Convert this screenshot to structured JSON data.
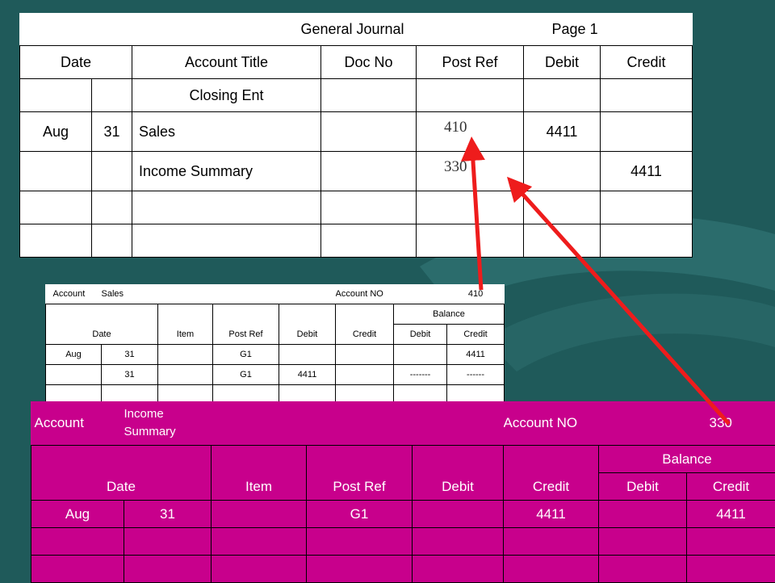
{
  "journal": {
    "title": "General Journal",
    "page": "Page 1",
    "headers": {
      "date": "Date",
      "account_title": "Account Title",
      "doc_no": "Doc No",
      "post_ref": "Post Ref",
      "debit": "Debit",
      "credit": "Credit"
    },
    "rows": [
      {
        "month": "",
        "day": "",
        "account": "Closing Ent",
        "doc": "",
        "post_ref": "",
        "debit": "",
        "credit": ""
      },
      {
        "month": "Aug",
        "day": "31",
        "account": "Sales",
        "doc": "",
        "post_ref": "410",
        "debit": "4411",
        "credit": ""
      },
      {
        "month": "",
        "day": "",
        "account": "Income Summary",
        "doc": "",
        "post_ref": "330",
        "debit": "",
        "credit": "4411"
      }
    ]
  },
  "sales_ledger": {
    "account_label": "Account",
    "account_name": "Sales",
    "account_no_label": "Account NO",
    "account_no": "410",
    "headers": {
      "date": "Date",
      "item": "Item",
      "post_ref": "Post Ref",
      "debit": "Debit",
      "credit": "Credit",
      "balance": "Balance",
      "bal_debit": "Debit",
      "bal_credit": "Credit"
    },
    "rows": [
      {
        "month": "Aug",
        "day": "31",
        "item": "",
        "post_ref": "G1",
        "debit": "",
        "credit": "",
        "bal_debit": "",
        "bal_credit": "4411"
      },
      {
        "month": "",
        "day": "31",
        "item": "",
        "post_ref": "G1",
        "debit": "4411",
        "credit": "",
        "bal_debit": "-------",
        "bal_credit": "------"
      }
    ]
  },
  "income_ledger": {
    "account_label": "Account",
    "account_name": "Income Summary",
    "account_no_label": "Account NO",
    "account_no": "330",
    "headers": {
      "date": "Date",
      "item": "Item",
      "post_ref": "Post Ref",
      "debit": "Debit",
      "credit": "Credit",
      "balance": "Balance",
      "bal_debit": "Debit",
      "bal_credit": "Credit"
    },
    "rows": [
      {
        "month": "Aug",
        "day": "31",
        "item": "",
        "post_ref": "G1",
        "debit": "",
        "credit": "4411",
        "bal_debit": "",
        "bal_credit": "4411"
      }
    ]
  },
  "colors": {
    "background": "#1f5a5a",
    "income_fill": "#c8008c",
    "arrow": "#ee1c1c"
  }
}
